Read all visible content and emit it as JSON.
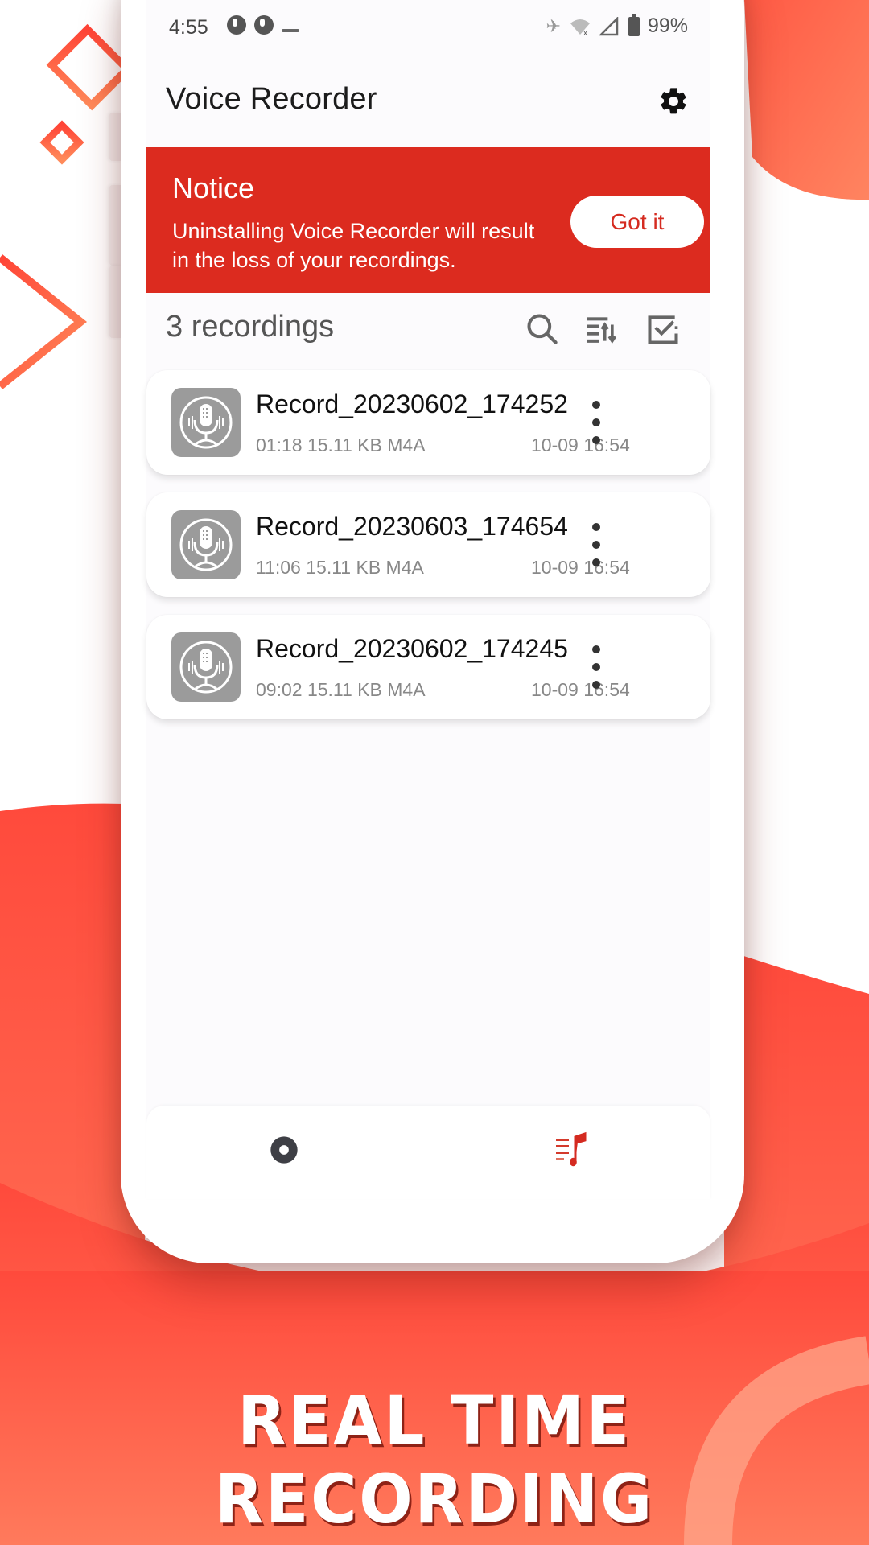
{
  "status_bar": {
    "time": "4:55",
    "battery": "99%",
    "icons": [
      "notification-icon",
      "notification-icon",
      "minimize-icon",
      "airplane-icon",
      "wifi-off-icon",
      "signal-off-icon",
      "battery-icon"
    ]
  },
  "app_bar": {
    "title": "Voice Recorder",
    "settings_icon": "gear-icon"
  },
  "notice": {
    "title": "Notice",
    "message": "Uninstalling Voice Recorder will result in the loss of your recordings.",
    "button_label": "Got it"
  },
  "list_header": {
    "count_label": "3 recordings",
    "actions": [
      "search-icon",
      "sort-icon",
      "select-icon"
    ]
  },
  "recordings": [
    {
      "name": "Record_20230602_174252",
      "meta": "01:18 15.11 KB M4A",
      "date": "10-09 16:54"
    },
    {
      "name": "Record_20230603_174654",
      "meta": "11:06 15.11 KB M4A",
      "date": "10-09 16:54"
    },
    {
      "name": "Record_20230602_174245",
      "meta": "09:02 15.11 KB M4A",
      "date": "10-09 16:54"
    }
  ],
  "bottom_nav": {
    "items": [
      {
        "name": "record",
        "icon": "record-icon",
        "active": false
      },
      {
        "name": "recordings",
        "icon": "music-list-icon",
        "active": true
      }
    ]
  },
  "tagline": "REAL TIME RECORDING",
  "colors": {
    "accent": "#dc2b1f",
    "background_coral": "#ff6a4f",
    "icon_gray": "#9b9b9b"
  }
}
